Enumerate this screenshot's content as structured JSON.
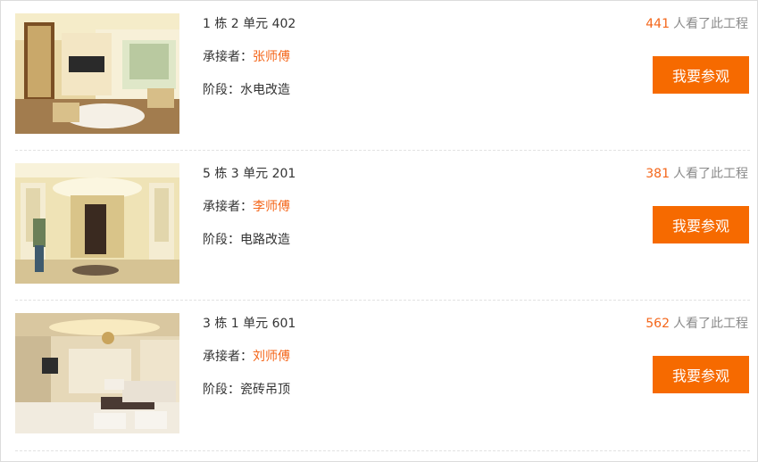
{
  "projects": [
    {
      "unit": "1 栋 2 单元 402",
      "contractor_label": "承接者：",
      "contractor_name": "张师傅",
      "stage_label": "阶段：",
      "stage": "水电改造",
      "view_count": "441",
      "view_suffix": "人看了此工程",
      "button_label": "我要参观"
    },
    {
      "unit": "5 栋 3 单元 201",
      "contractor_label": "承接者：",
      "contractor_name": "李师傅",
      "stage_label": "阶段：",
      "stage": "电路改造",
      "view_count": "381",
      "view_suffix": "人看了此工程",
      "button_label": "我要参观"
    },
    {
      "unit": "3 栋 1 单元 601",
      "contractor_label": "承接者：",
      "contractor_name": "刘师傅",
      "stage_label": "阶段：",
      "stage": "瓷砖吊顶",
      "view_count": "562",
      "view_suffix": "人看了此工程",
      "button_label": "我要参观"
    }
  ],
  "colors": {
    "accent": "#f4661a",
    "button": "#f66a00",
    "muted": "#8a8a8a"
  }
}
